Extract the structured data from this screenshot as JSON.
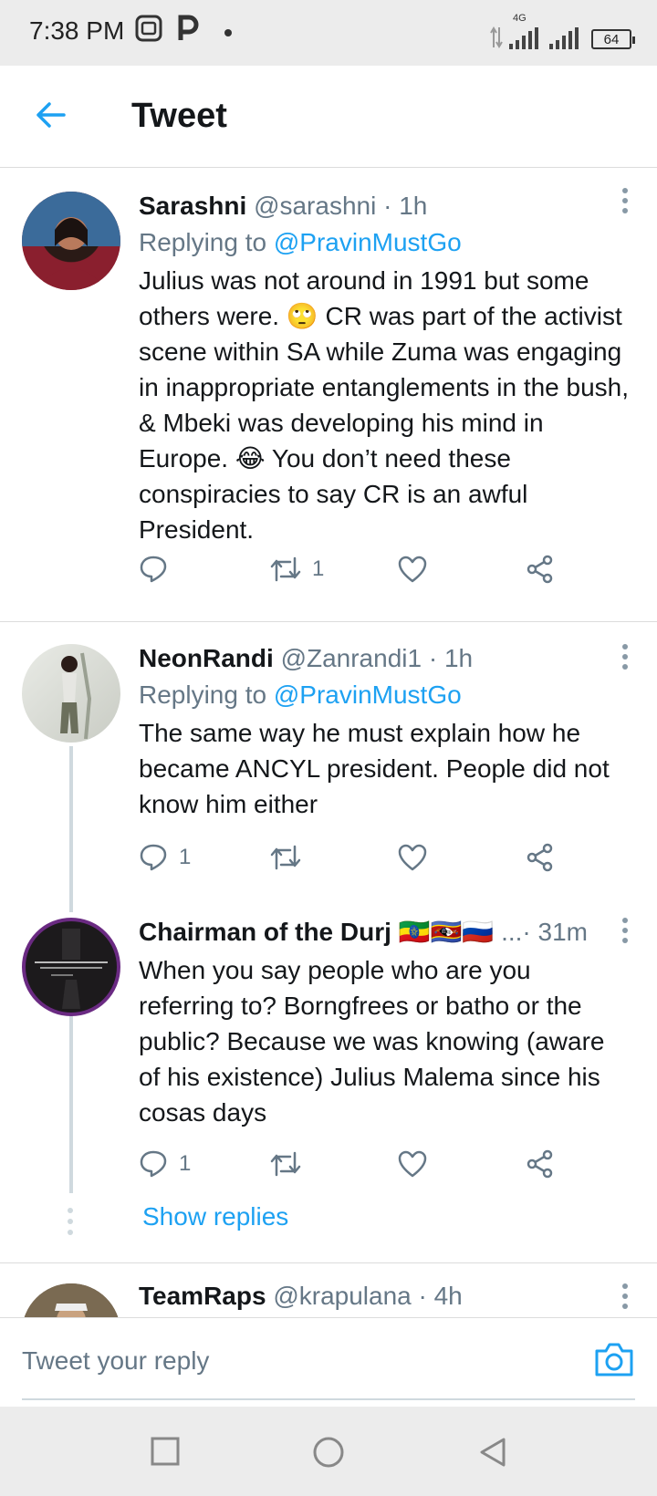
{
  "status_bar": {
    "time": "7:38 PM",
    "network": "4G",
    "battery": "64"
  },
  "header": {
    "title": "Tweet",
    "back_icon": "arrow-left-icon"
  },
  "colors": {
    "accent": "#1da1f2",
    "secondary_text": "#657786",
    "primary_text": "#14171a"
  },
  "tweets": [
    {
      "name": "Sarashni",
      "handle": "@sarashni · 1h",
      "replying_label": "Replying to ",
      "replying_to": "@PravinMustGo",
      "text": "Julius was not around in 1991 but some others were. 🙄 CR was part of the activist scene within SA while Zuma was engaging in inappropriate entanglements in the bush, & Mbeki was developing his mind in Europe. 😂 You don’t need these conspiracies to say CR is an awful President.",
      "reply_count": "",
      "retweet_count": "1",
      "like_count": ""
    },
    {
      "name": "NeonRandi",
      "handle": "@Zanrandi1 · 1h",
      "replying_label": "Replying to ",
      "replying_to": "@PravinMustGo",
      "text": "The same way he must explain how he became ANCYL president. People did not know him either",
      "reply_count": "1",
      "retweet_count": "",
      "like_count": ""
    },
    {
      "name": "Chairman of the Durj 🇪🇹🇸🇿🇷🇺",
      "handle": "...· 31m",
      "text": "When you say people who are you referring to? Borngfrees or batho or the public? Because we was knowing (aware of his existence) Julius Malema since his cosas days",
      "reply_count": "1",
      "retweet_count": "",
      "like_count": ""
    },
    {
      "name": "TeamRaps",
      "handle": "@krapulana · 4h"
    }
  ],
  "show_replies": "Show replies",
  "reply_bar": {
    "placeholder": "Tweet your reply",
    "camera_icon": "camera-icon"
  },
  "nav": [
    "square-icon",
    "circle-icon",
    "triangle-back-icon"
  ]
}
